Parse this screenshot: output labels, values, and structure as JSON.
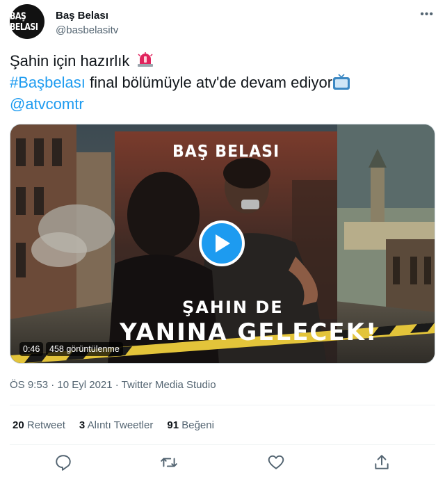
{
  "header": {
    "avatar_text": "BAŞ BELASI",
    "display_name": "Baş Belası",
    "handle": "@basbelasitv",
    "more_icon": "more-dots-icon"
  },
  "tweet": {
    "line1": "Şahin için hazırlık",
    "line1_emoji": "police-light-icon",
    "hashtag": "#Başbelası",
    "line2": " final bölümüyle atv'de devam ediyor",
    "line2_emoji": "television-icon",
    "mention": "@atvcomtr"
  },
  "media": {
    "brand_text": "BAŞ BELASI",
    "overlay_line1": "ŞAHIN DE",
    "overlay_line2": "YANINA GELECEK!",
    "duration": "0:46",
    "views": "458 görüntülenme",
    "play_icon": "play-icon"
  },
  "meta": {
    "timestamp": "ÖS 9:53 · 10 Eyl 2021 · Twitter Media Studio"
  },
  "stats": {
    "retweets_count": "20",
    "retweets_label": "Retweet",
    "quotes_count": "3",
    "quotes_label": "Alıntı Tweetler",
    "likes_count": "91",
    "likes_label": "Beğeni"
  },
  "colors": {
    "link": "#1d9bf0",
    "secondary": "#536471",
    "text": "#0f1419",
    "play_button": "#1d9bf0"
  }
}
